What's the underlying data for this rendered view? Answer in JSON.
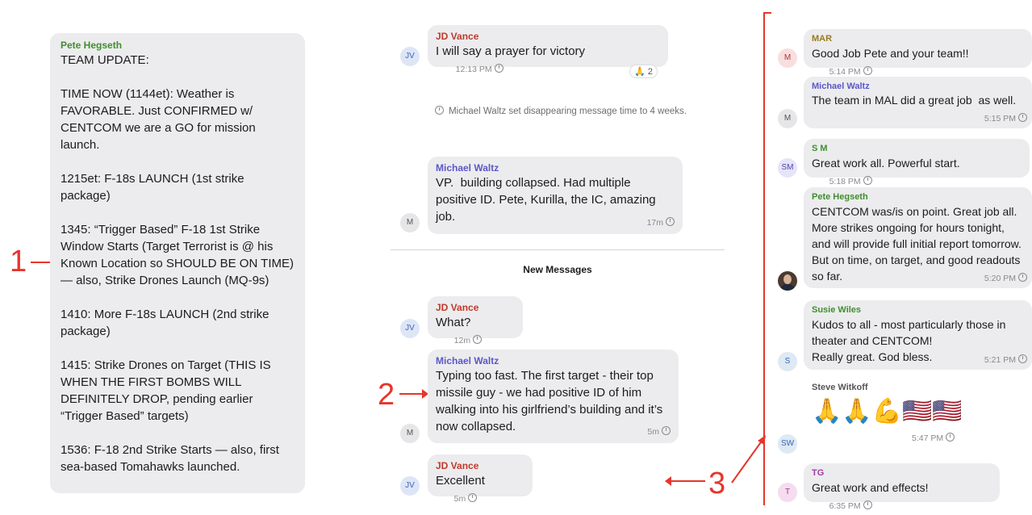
{
  "colors": {
    "annotation_red": "#e8352a",
    "bubble_gray": "#ececee",
    "name_green": "#3f8f2e",
    "name_red": "#c0392b",
    "name_purple": "#5b58c7",
    "name_olive": "#9a7a1f",
    "name_magenta": "#a13aa8"
  },
  "annotations": {
    "one": "1",
    "two": "2",
    "three": "3"
  },
  "panel1": {
    "sender": "Pete Hegseth",
    "text": "TEAM UPDATE:\n\nTIME NOW (1144et): Weather is FAVORABLE. Just CONFIRMED w/ CENTCOM we are a GO for mission launch.\n\n1215et: F-18s LAUNCH (1st strike package)\n\n1345: “Trigger Based” F-18 1st Strike Window Starts (Target Terrorist is @ his Known Location so SHOULD BE ON TIME) — also, Strike Drones Launch (MQ-9s)\n\n1410: More F-18s LAUNCH (2nd strike package)\n\n1415: Strike Drones on Target (THIS IS WHEN THE FIRST BOMBS WILL DEFINITELY DROP, pending earlier “Trigger Based” targets)\n\n1536: F-18 2nd Strike Starts — also, first sea-based Tomahawks launched."
  },
  "panel2": {
    "msg1": {
      "avatar": "JV",
      "sender": "JD Vance",
      "text": "I will say a prayer for victory",
      "time": "12:13 PM",
      "reaction_emoji": "🙏",
      "reaction_count": "2"
    },
    "system": "Michael Waltz set disappearing message time to 4 weeks.",
    "msg2": {
      "avatar": "M",
      "sender": "Michael Waltz",
      "text": "VP.  building collapsed. Had multiple positive ID. Pete, Kurilla, the IC, amazing job.",
      "time": "17m"
    },
    "divider": "New Messages",
    "msg3": {
      "avatar": "JV",
      "sender": "JD Vance",
      "text": "What?",
      "time": "12m"
    },
    "msg4": {
      "avatar": "M",
      "sender": "Michael Waltz",
      "text": "Typing too fast. The first target - their top missile guy - we had positive ID of him walking into his girlfriend’s building and it’s now collapsed.",
      "time": "5m"
    },
    "msg5": {
      "avatar": "JV",
      "sender": "JD Vance",
      "text": "Excellent",
      "time": "5m"
    }
  },
  "panel3": {
    "msg1": {
      "avatar": "M",
      "sender": "MAR",
      "text": "Good Job Pete and your team!!",
      "time": "5:14 PM"
    },
    "msg2": {
      "avatar": "M",
      "sender": "Michael Waltz",
      "text": "The team in MAL did a great job  as well.",
      "time": "5:15 PM"
    },
    "msg3": {
      "avatar": "SM",
      "sender": "S M",
      "text": "Great work all. Powerful start.",
      "time": "5:18 PM"
    },
    "msg4": {
      "sender": "Pete Hegseth",
      "text": "CENTCOM was/is on point. Great job all. More strikes ongoing for hours tonight, and will provide full initial report tomorrow. But on time, on target, and good readouts so far.",
      "time": "5:20 PM"
    },
    "msg5": {
      "avatar": "S",
      "sender": "Susie Wiles",
      "text": "Kudos to all - most particularly those in theater and CENTCOM!\nReally great. God bless.",
      "time": "5:21 PM"
    },
    "msg6": {
      "avatar": "SW",
      "sender": "Steve Witkoff",
      "emojis": "🙏🙏💪🇺🇸🇺🇸",
      "time": "5:47 PM"
    },
    "msg7": {
      "avatar": "T",
      "sender": "TG",
      "text": "Great work and effects!",
      "time": "6:35 PM"
    }
  }
}
